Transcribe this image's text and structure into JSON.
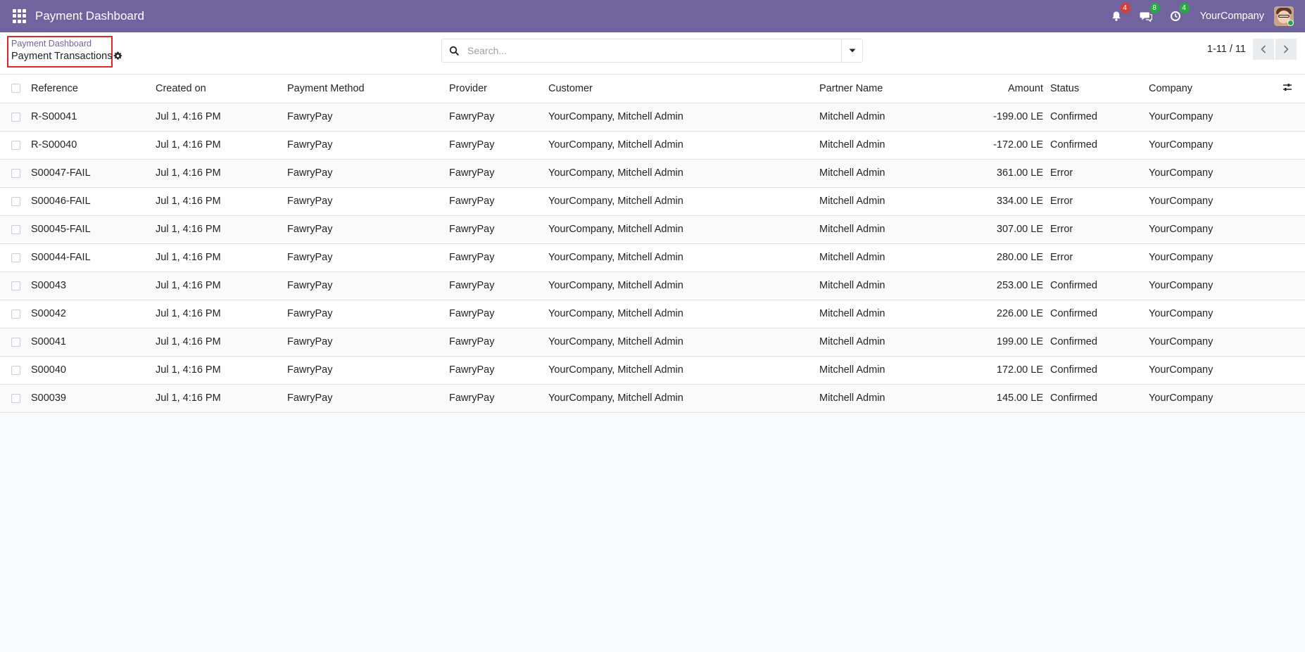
{
  "navbar": {
    "app_title": "Payment Dashboard",
    "activity_count": "4",
    "messages_count": "8",
    "clock_count": "4",
    "company": "YourCompany",
    "color": "#71639e"
  },
  "breadcrumb": {
    "parent": "Payment Dashboard",
    "current": "Payment Transactions"
  },
  "search": {
    "placeholder": "Search..."
  },
  "pager": {
    "value": "1-11 / 11"
  },
  "table": {
    "headers": {
      "reference": "Reference",
      "created_on": "Created on",
      "payment_method": "Payment Method",
      "provider": "Provider",
      "customer": "Customer",
      "partner_name": "Partner Name",
      "amount": "Amount",
      "status": "Status",
      "company": "Company"
    },
    "rows": [
      {
        "reference": "R-S00041",
        "created_on": "Jul 1, 4:16 PM",
        "payment_method": "FawryPay",
        "provider": "FawryPay",
        "customer": "YourCompany, Mitchell Admin",
        "partner_name": "Mitchell Admin",
        "amount": "-199.00 LE",
        "status": "Confirmed",
        "company": "YourCompany"
      },
      {
        "reference": "R-S00040",
        "created_on": "Jul 1, 4:16 PM",
        "payment_method": "FawryPay",
        "provider": "FawryPay",
        "customer": "YourCompany, Mitchell Admin",
        "partner_name": "Mitchell Admin",
        "amount": "-172.00 LE",
        "status": "Confirmed",
        "company": "YourCompany"
      },
      {
        "reference": "S00047-FAIL",
        "created_on": "Jul 1, 4:16 PM",
        "payment_method": "FawryPay",
        "provider": "FawryPay",
        "customer": "YourCompany, Mitchell Admin",
        "partner_name": "Mitchell Admin",
        "amount": "361.00 LE",
        "status": "Error",
        "company": "YourCompany"
      },
      {
        "reference": "S00046-FAIL",
        "created_on": "Jul 1, 4:16 PM",
        "payment_method": "FawryPay",
        "provider": "FawryPay",
        "customer": "YourCompany, Mitchell Admin",
        "partner_name": "Mitchell Admin",
        "amount": "334.00 LE",
        "status": "Error",
        "company": "YourCompany"
      },
      {
        "reference": "S00045-FAIL",
        "created_on": "Jul 1, 4:16 PM",
        "payment_method": "FawryPay",
        "provider": "FawryPay",
        "customer": "YourCompany, Mitchell Admin",
        "partner_name": "Mitchell Admin",
        "amount": "307.00 LE",
        "status": "Error",
        "company": "YourCompany"
      },
      {
        "reference": "S00044-FAIL",
        "created_on": "Jul 1, 4:16 PM",
        "payment_method": "FawryPay",
        "provider": "FawryPay",
        "customer": "YourCompany, Mitchell Admin",
        "partner_name": "Mitchell Admin",
        "amount": "280.00 LE",
        "status": "Error",
        "company": "YourCompany"
      },
      {
        "reference": "S00043",
        "created_on": "Jul 1, 4:16 PM",
        "payment_method": "FawryPay",
        "provider": "FawryPay",
        "customer": "YourCompany, Mitchell Admin",
        "partner_name": "Mitchell Admin",
        "amount": "253.00 LE",
        "status": "Confirmed",
        "company": "YourCompany"
      },
      {
        "reference": "S00042",
        "created_on": "Jul 1, 4:16 PM",
        "payment_method": "FawryPay",
        "provider": "FawryPay",
        "customer": "YourCompany, Mitchell Admin",
        "partner_name": "Mitchell Admin",
        "amount": "226.00 LE",
        "status": "Confirmed",
        "company": "YourCompany"
      },
      {
        "reference": "S00041",
        "created_on": "Jul 1, 4:16 PM",
        "payment_method": "FawryPay",
        "provider": "FawryPay",
        "customer": "YourCompany, Mitchell Admin",
        "partner_name": "Mitchell Admin",
        "amount": "199.00 LE",
        "status": "Confirmed",
        "company": "YourCompany"
      },
      {
        "reference": "S00040",
        "created_on": "Jul 1, 4:16 PM",
        "payment_method": "FawryPay",
        "provider": "FawryPay",
        "customer": "YourCompany, Mitchell Admin",
        "partner_name": "Mitchell Admin",
        "amount": "172.00 LE",
        "status": "Confirmed",
        "company": "YourCompany"
      },
      {
        "reference": "S00039",
        "created_on": "Jul 1, 4:16 PM",
        "payment_method": "FawryPay",
        "provider": "FawryPay",
        "customer": "YourCompany, Mitchell Admin",
        "partner_name": "Mitchell Admin",
        "amount": "145.00 LE",
        "status": "Confirmed",
        "company": "YourCompany"
      }
    ]
  }
}
